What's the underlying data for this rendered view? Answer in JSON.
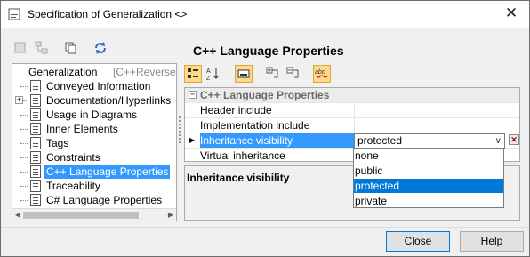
{
  "window": {
    "title": "Specification of Generalization <>",
    "close_glyph": "✕"
  },
  "tree": {
    "root": {
      "prefix": "Generalization",
      "suffix": "[C++Reverse::Unio"
    },
    "items": [
      {
        "label": "Conveyed Information",
        "expander": ""
      },
      {
        "label": "Documentation/Hyperlinks",
        "expander": "+"
      },
      {
        "label": "Usage in Diagrams",
        "expander": ""
      },
      {
        "label": "Inner Elements",
        "expander": ""
      },
      {
        "label": "Tags",
        "expander": ""
      },
      {
        "label": "Constraints",
        "expander": ""
      },
      {
        "label": "C++ Language Properties",
        "expander": "",
        "selected": true
      },
      {
        "label": "Traceability",
        "expander": ""
      },
      {
        "label": "C# Language Properties",
        "expander": ""
      }
    ]
  },
  "main": {
    "heading": "C++ Language Properties",
    "grid": {
      "group_label": "C++ Language Properties",
      "rows": [
        {
          "name": "Header include",
          "value": ""
        },
        {
          "name": "Implementation include",
          "value": ""
        },
        {
          "name": "Inheritance visibility",
          "value": "protected"
        },
        {
          "name": "Virtual inheritance",
          "value": ""
        }
      ]
    },
    "description_title": "Inheritance visibility",
    "dropdown_options": [
      "none",
      "public",
      "protected",
      "private"
    ],
    "selected_option": "protected"
  },
  "buttons": {
    "close": "Close",
    "help": "Help"
  },
  "colors": {
    "selection": "#3399ff",
    "dropdown_selection": "#0078d7",
    "toggle_on": "#ffd88a"
  }
}
